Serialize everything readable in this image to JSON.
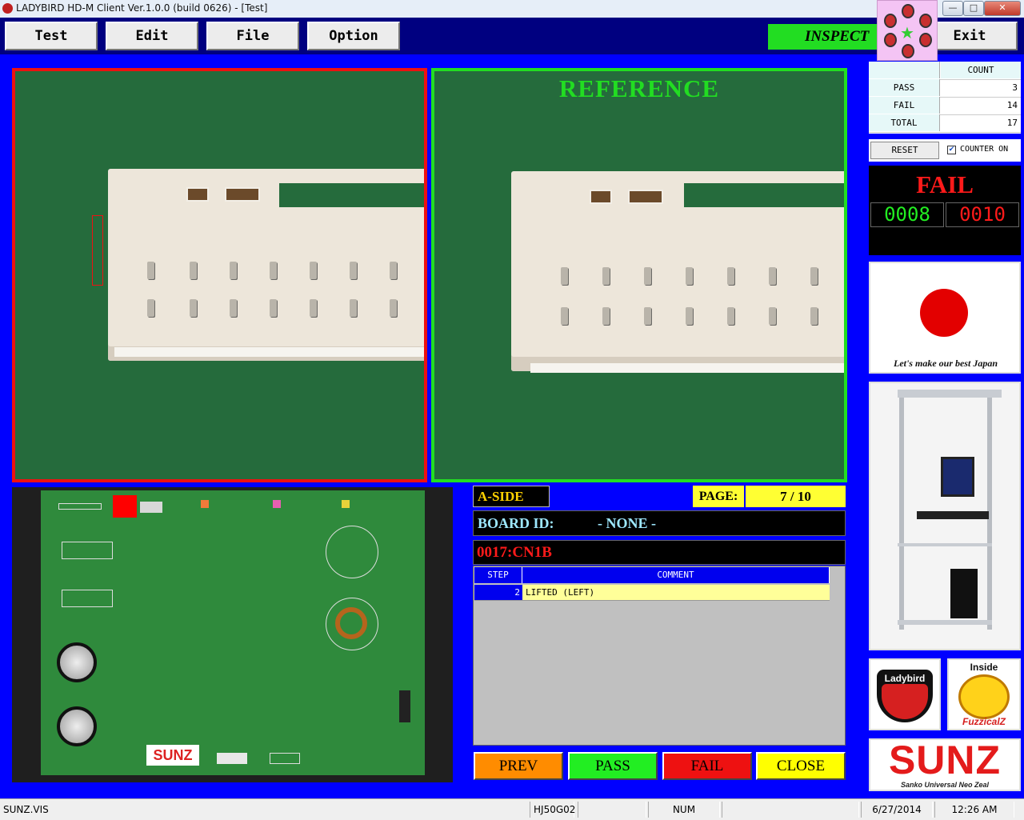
{
  "window": {
    "title": "LADYBIRD HD-M Client Ver.1.0.0  (build 0626) - [Test]",
    "minimize_glyph": "—",
    "maximize_glyph": "□",
    "close_glyph": "✕"
  },
  "menu": {
    "test": "Test",
    "edit": "Edit",
    "file": "File",
    "option": "Option",
    "exit": "Exit",
    "inspect": "INSPECT"
  },
  "reference": {
    "title": "REFERENCE"
  },
  "info": {
    "side": "A-SIDE",
    "page_label": "PAGE:",
    "page_value": "7 / 10",
    "board_id_label": "BOARD ID:",
    "board_id_value": "- NONE -",
    "part": "0017:CN1B"
  },
  "defects": {
    "columns": [
      "STEP",
      "COMMENT"
    ],
    "rows": [
      {
        "step": "2",
        "comment": "LIFTED (LEFT)"
      }
    ]
  },
  "actions": {
    "prev": "PREV",
    "pass": "PASS",
    "fail": "FAIL",
    "close": "CLOSE"
  },
  "counter": {
    "header": "COUNT",
    "pass_label": "PASS",
    "pass_value": "3",
    "fail_label": "FAIL",
    "fail_value": "14",
    "total_label": "TOTAL",
    "total_value": "17",
    "reset": "RESET",
    "counter_on_label": "COUNTER ON",
    "counter_on_checked": true
  },
  "result": {
    "status": "FAIL",
    "count_left": "0008",
    "count_right": "0010"
  },
  "logos": {
    "japan_caption": "Let's make our best Japan",
    "ladybird": "Ladybird",
    "inside": "Inside",
    "fuzzicalz": "FuzzicalZ",
    "sunz": "SUNZ",
    "sunz_tagline": "Sanko Universal Neo Zeal"
  },
  "board": {
    "silk_logo": "SUNZ"
  },
  "statusbar": {
    "file": "SUNZ.VIS",
    "model": "HJ50G02",
    "num": "NUM",
    "date": "6/27/2014",
    "time": "12:26 AM"
  },
  "colors": {
    "background": "#0000ff",
    "menubar": "#000080",
    "fail_red": "#ee1111",
    "pass_green": "#22dd22",
    "highlight_yellow": "#ffff33"
  }
}
